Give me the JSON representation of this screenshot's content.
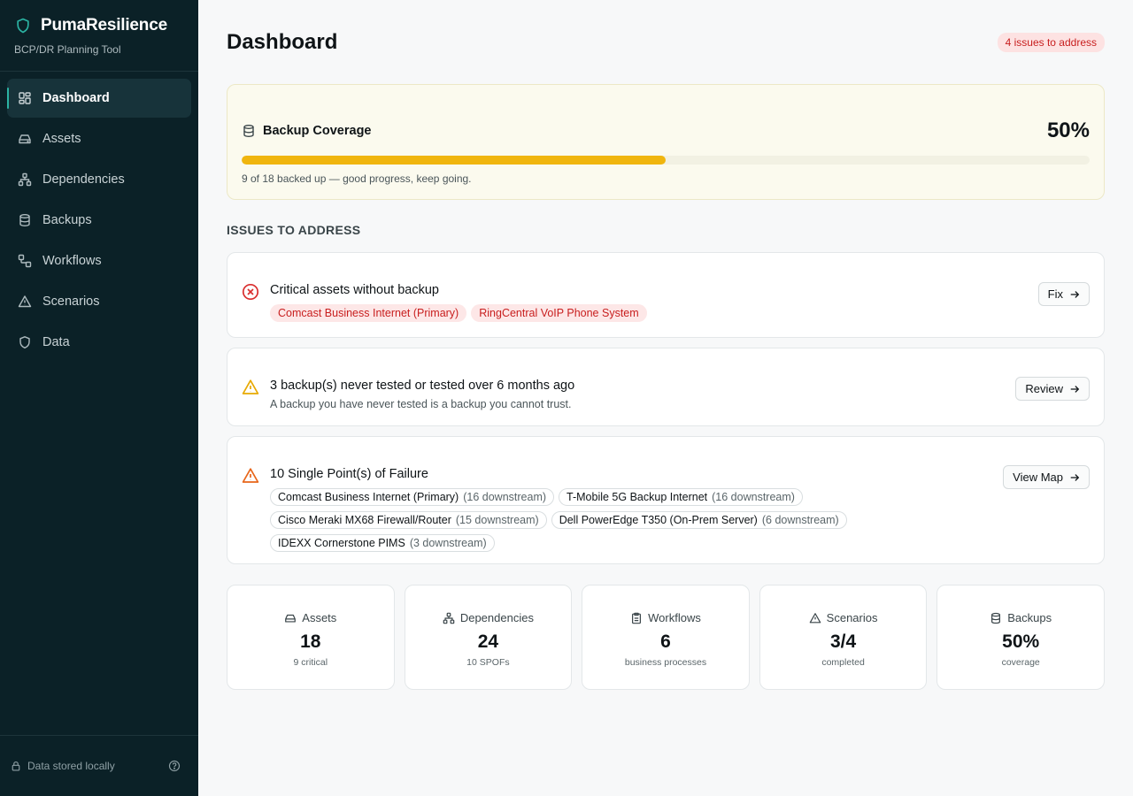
{
  "brand": {
    "name": "PumaResilience",
    "subtitle": "BCP/DR Planning Tool"
  },
  "nav": [
    {
      "label": "Dashboard",
      "icon": "dashboard-icon",
      "active": true
    },
    {
      "label": "Assets",
      "icon": "hard-drive-icon"
    },
    {
      "label": "Dependencies",
      "icon": "network-icon"
    },
    {
      "label": "Backups",
      "icon": "database-icon"
    },
    {
      "label": "Workflows",
      "icon": "workflow-icon"
    },
    {
      "label": "Scenarios",
      "icon": "warning-icon"
    },
    {
      "label": "Data",
      "icon": "shield-icon"
    }
  ],
  "footer": {
    "storage_label": "Data stored locally"
  },
  "header": {
    "title": "Dashboard",
    "issues_badge": "4 issues to address"
  },
  "coverage": {
    "title": "Backup Coverage",
    "percent_label": "50%",
    "progress": 0.5,
    "note": "9 of 18 backed up — good progress, keep going."
  },
  "issues_section": {
    "label": "ISSUES TO ADDRESS"
  },
  "issues": {
    "critical": {
      "title": "Critical assets without backup",
      "tags": [
        "Comcast Business Internet (Primary)",
        "RingCentral VoIP Phone System"
      ],
      "action": "Fix"
    },
    "untested": {
      "title": "3 backup(s) never tested or tested over 6 months ago",
      "desc": "A backup you have never tested is a backup you cannot trust.",
      "action": "Review"
    },
    "spof": {
      "title": "10 Single Point(s) of Failure",
      "action": "View Map",
      "items": [
        {
          "name": "Comcast Business Internet (Primary)",
          "downstream": "(16 downstream)"
        },
        {
          "name": "T-Mobile 5G Backup Internet",
          "downstream": "(16 downstream)"
        },
        {
          "name": "Cisco Meraki MX68 Firewall/Router",
          "downstream": "(15 downstream)"
        },
        {
          "name": "Dell PowerEdge T350 (On-Prem Server)",
          "downstream": "(6 downstream)"
        },
        {
          "name": "IDEXX Cornerstone PIMS",
          "downstream": "(3 downstream)"
        }
      ]
    }
  },
  "stats": [
    {
      "label": "Assets",
      "value": "18",
      "sub": "9 critical",
      "icon": "hard-drive-icon"
    },
    {
      "label": "Dependencies",
      "value": "24",
      "sub": "10 SPOFs",
      "icon": "network-icon"
    },
    {
      "label": "Workflows",
      "value": "6",
      "sub": "business processes",
      "icon": "clipboard-icon"
    },
    {
      "label": "Scenarios",
      "value": "3/4",
      "sub": "completed",
      "icon": "warning-icon"
    },
    {
      "label": "Backups",
      "value": "50%",
      "sub": "coverage",
      "icon": "database-icon"
    }
  ],
  "colors": {
    "sidebar_bg": "#0b2127",
    "accent_teal": "#2bb3a3",
    "progress_yellow": "#f0b50e",
    "danger_red": "#c81e1e",
    "warning_yellow": "#e8a900",
    "warning_orange": "#e8661a"
  }
}
